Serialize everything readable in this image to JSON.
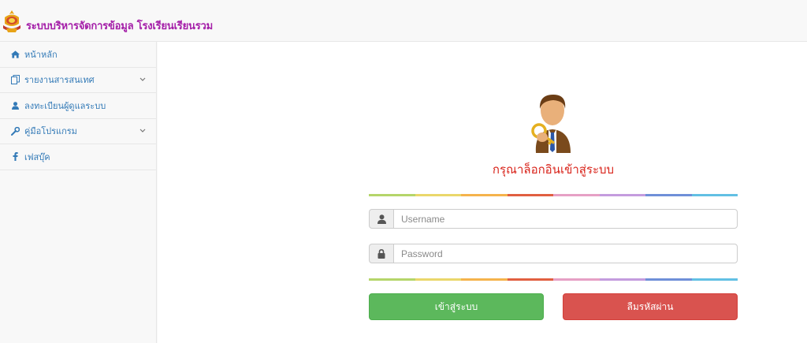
{
  "header": {
    "app_title": "ระบบบริหารจัดการข้อมูล โรงเรียนเรียนรวม",
    "logo_icon": "school-emblem-icon"
  },
  "sidebar": {
    "items": [
      {
        "label": "หน้าหลัก",
        "icon": "home-icon",
        "has_submenu": false
      },
      {
        "label": "รายงานสารสนเทศ",
        "icon": "copy-icon",
        "has_submenu": true
      },
      {
        "label": "ลงทะเบียนผู้ดูแลระบบ",
        "icon": "user-icon",
        "has_submenu": false
      },
      {
        "label": "คู่มือโปรแกรม",
        "icon": "wrench-icon",
        "has_submenu": true
      },
      {
        "label": "เฟสบุ๊ค",
        "icon": "facebook-icon",
        "has_submenu": false
      }
    ]
  },
  "login": {
    "heading": "กรุณาล็อกอินเข้าสู่ระบบ",
    "username_placeholder": "Username",
    "password_placeholder": "Password",
    "login_button": "เข้าสู่ระบบ",
    "forgot_button": "ลืมรหัสผ่าน"
  },
  "colors": {
    "title": "#a41ea8",
    "link": "#337ab7",
    "heading": "#d9251c",
    "success": "#5cb85c",
    "danger": "#d9534f",
    "rainbow": [
      "#b5d56a",
      "#ead76b",
      "#f5b34c",
      "#e15f41",
      "#e6a0c5",
      "#c49cde",
      "#6f8fd8",
      "#62c0e4"
    ]
  }
}
